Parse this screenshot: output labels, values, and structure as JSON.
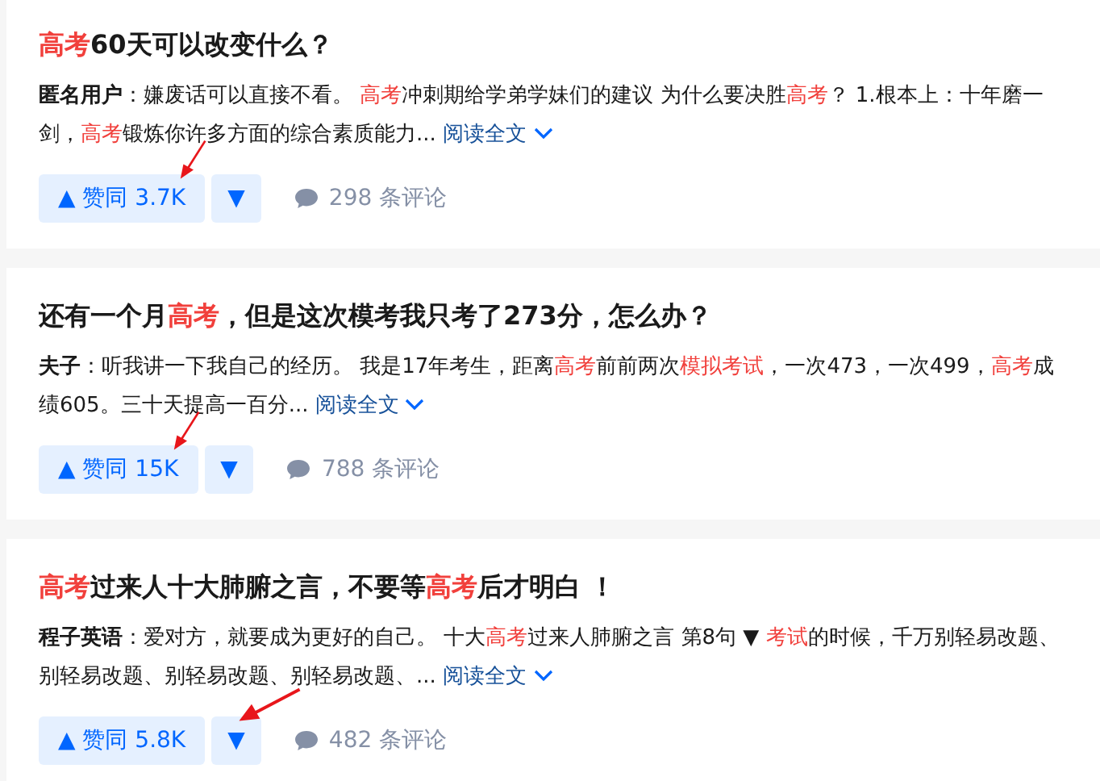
{
  "results": [
    {
      "title": [
        {
          "text": "高考",
          "highlight": true
        },
        {
          "text": "60天可以改变什么？",
          "highlight": false
        }
      ],
      "author": "匿名用户",
      "excerpt": [
        {
          "text": "：嫌废话可以直接不看。 ",
          "highlight": false
        },
        {
          "text": "高考",
          "highlight": true
        },
        {
          "text": "冲刺期给学弟学妹们的建议 为什么要决胜",
          "highlight": false
        },
        {
          "text": "高考",
          "highlight": true
        },
        {
          "text": "？ 1.根本上：十年磨一剑，",
          "highlight": false
        },
        {
          "text": "高考",
          "highlight": true
        },
        {
          "text": "锻炼你许多方面的综合素质能力...",
          "highlight": false
        }
      ],
      "read_more": "阅读全文",
      "upvote": "▲ 赞同 3.7K",
      "downvote": "▼",
      "comments": "298 条评论",
      "upvote_arrow": true,
      "downvote_arrow": false
    },
    {
      "title": [
        {
          "text": "还有一个月",
          "highlight": false
        },
        {
          "text": "高考",
          "highlight": true
        },
        {
          "text": "，但是这次模考我只考了273分，怎么办？",
          "highlight": false
        }
      ],
      "author": "夫子",
      "excerpt": [
        {
          "text": "：听我讲一下我自己的经历。 我是17年考生，距离",
          "highlight": false
        },
        {
          "text": "高考",
          "highlight": true
        },
        {
          "text": "前前两次",
          "highlight": false
        },
        {
          "text": "模拟考试",
          "highlight": true
        },
        {
          "text": "，一次473，一次499，",
          "highlight": false
        },
        {
          "text": "高考",
          "highlight": true
        },
        {
          "text": "成绩605。三十天提高一百分...",
          "highlight": false
        }
      ],
      "read_more": "阅读全文",
      "upvote": "▲ 赞同 15K",
      "downvote": "▼",
      "comments": "788 条评论",
      "upvote_arrow": true,
      "downvote_arrow": false
    },
    {
      "title": [
        {
          "text": "高考",
          "highlight": true
        },
        {
          "text": "过来人十大肺腑之言，不要等",
          "highlight": false
        },
        {
          "text": "高考",
          "highlight": true
        },
        {
          "text": "后才明白 ！",
          "highlight": false
        }
      ],
      "author": "程子英语",
      "excerpt": [
        {
          "text": "：爱对方，就要成为更好的自己。 十大",
          "highlight": false
        },
        {
          "text": "高考",
          "highlight": true
        },
        {
          "text": "过来人肺腑之言 第8句 ▼ ",
          "highlight": false
        },
        {
          "text": "考试",
          "highlight": true
        },
        {
          "text": "的时候，千万别轻易改题、别轻易改题、别轻易改题、别轻易改题、...",
          "highlight": false
        }
      ],
      "read_more": "阅读全文",
      "upvote": "▲ 赞同 5.8K",
      "downvote": "▼",
      "comments": "482 条评论",
      "upvote_arrow": false,
      "downvote_arrow": true
    }
  ]
}
